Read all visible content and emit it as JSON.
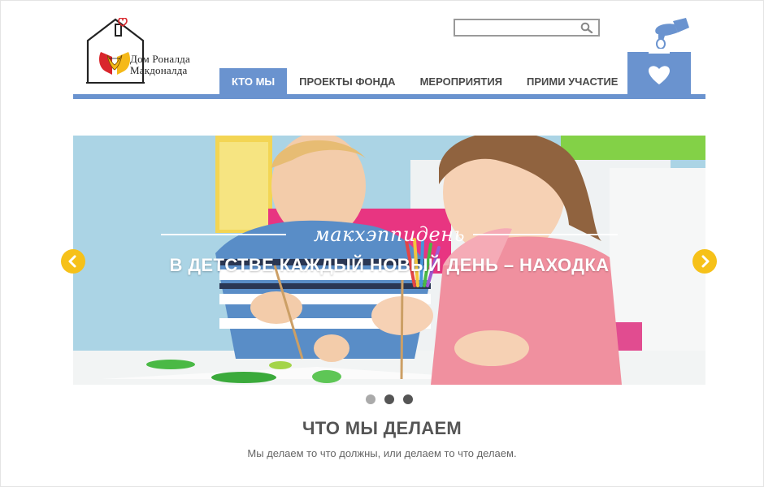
{
  "brand": {
    "name_line1": "Дом Роналда",
    "name_line2": "Макдоналда",
    "icons": [
      "house-logo-icon",
      "heart-icon",
      "hands-icon"
    ]
  },
  "search": {
    "value": "",
    "placeholder": "",
    "icon": "search-icon"
  },
  "nav": {
    "items": [
      {
        "label": "КТО МЫ",
        "active": true
      },
      {
        "label": "ПРОЕКТЫ ФОНДА",
        "active": false
      },
      {
        "label": "МЕРОПРИЯТИЯ",
        "active": false
      },
      {
        "label": "ПРИМИ УЧАСТИЕ",
        "active": false
      }
    ]
  },
  "donate": {
    "icon": "donation-box-icon"
  },
  "slider": {
    "script_text": "макхэппидень",
    "headline": "В ДЕТСТВЕ КАЖДЫЙ НОВЫЙ ДЕНЬ – НАХОДКА",
    "prev_icon": "chevron-left-icon",
    "next_icon": "chevron-right-icon",
    "dots": [
      {
        "active": false
      },
      {
        "active": true
      },
      {
        "active": true
      }
    ]
  },
  "section": {
    "title": "ЧТО МЫ ДЕЛАЕМ",
    "subtitle": "Мы делаем то что должны, или делаем то что делаем."
  },
  "colors": {
    "accent": "#6a93cf",
    "arrow": "#f6c119",
    "text": "#555555"
  }
}
